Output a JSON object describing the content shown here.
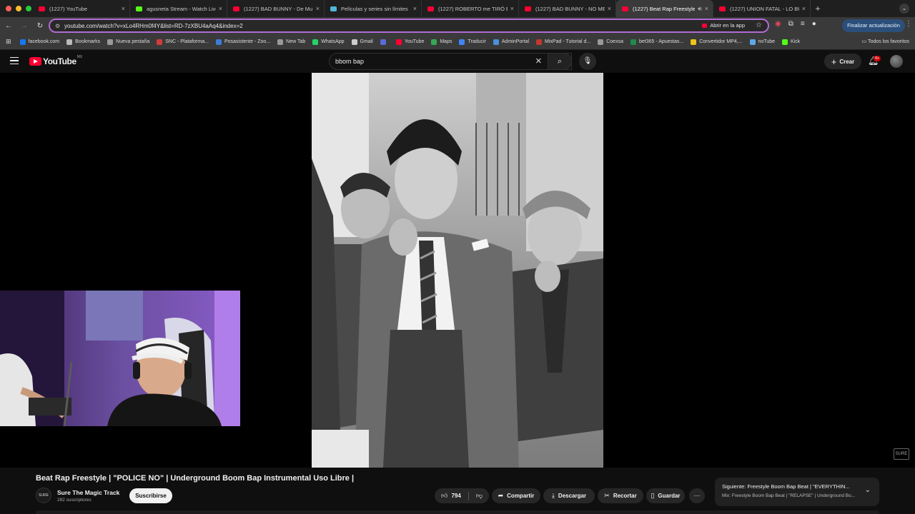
{
  "browser": {
    "tabs": [
      {
        "title": "(1227) YouTube",
        "icon": "youtube",
        "active": false
      },
      {
        "title": "agusneta Stream - Watch Live",
        "icon": "kick",
        "active": false
      },
      {
        "title": "(1227) BAD BUNNY - De Mu",
        "icon": "youtube",
        "active": false
      },
      {
        "title": "Películas y series sin límites",
        "icon": "pelis",
        "active": false
      },
      {
        "title": "(1227) ROBERTO me TIRÓ EL",
        "icon": "youtube",
        "active": false
      },
      {
        "title": "(1227) BAD BUNNY - NO ME",
        "icon": "youtube",
        "active": false
      },
      {
        "title": "(1227) Beat Rap Freestyle",
        "icon": "youtube",
        "active": true
      },
      {
        "title": "(1227) UNION FATAL - LO BU",
        "icon": "youtube",
        "active": false
      }
    ],
    "url": "youtube.com/watch?v=xLo4RHm0f4Y&list=RD-7zXBU4aAq4&index=2",
    "open_in_app": "Abrir en la app",
    "update_button": "Finalizar actualización",
    "bookmarks": [
      {
        "label": "facebook.com",
        "color": "#1877f2"
      },
      {
        "label": "Bookmarks",
        "color": "#bbbbbb"
      },
      {
        "label": "Nueva pestaña",
        "color": "#999999"
      },
      {
        "label": "SNC - Plataforma...",
        "color": "#d33b3b"
      },
      {
        "label": "Posasistente - Zoo...",
        "color": "#3b7dd8"
      },
      {
        "label": "New Tab",
        "color": "#999999"
      },
      {
        "label": "WhatsApp",
        "color": "#25d366"
      },
      {
        "label": "Gmail",
        "color": "#cccccc"
      },
      {
        "label": "",
        "color": "#5b6bd8"
      },
      {
        "label": "YouTube",
        "color": "#ff0033"
      },
      {
        "label": "Maps",
        "color": "#34a853"
      },
      {
        "label": "Traducir",
        "color": "#4285f4"
      },
      {
        "label": "AdminPortal",
        "color": "#4a90d9"
      },
      {
        "label": "MixPad - Tutorial d...",
        "color": "#c0392b"
      },
      {
        "label": "Coexsa",
        "color": "#999999"
      },
      {
        "label": "bet365 - Apuestas...",
        "color": "#1e8a4c"
      },
      {
        "label": "Convertidor MP4,...",
        "color": "#f0c419"
      },
      {
        "label": "noTube",
        "color": "#5fa8e8"
      },
      {
        "label": "Kick",
        "color": "#53fc18"
      }
    ],
    "all_favorites": "Todos los favoritos"
  },
  "youtube": {
    "region": "MX",
    "logo_text": "YouTube",
    "search_value": "bbom bap",
    "create_label": "Crear",
    "notification_badge": "9+"
  },
  "video": {
    "watermark": "SURE",
    "title": "Beat Rap Freestyle | \"POLICE NO\" | Underground Boom Bap Instrumental Uso Libre |",
    "channel_name": "Sure The Magic Track",
    "channel_avatar_text": "SURE",
    "subscribers": "282 suscriptores",
    "subscribe_label": "Suscribirse",
    "likes": "794",
    "share_label": "Compartir",
    "download_label": "Descargar",
    "clip_label": "Recortar",
    "save_label": "Guardar"
  },
  "next_up": {
    "title": "Siguiente: Freestyle Boom Bap Beat | \"EVERYTHIN...",
    "subtitle": "Mix: Freestyle Boom Bap Beat | \"RELAPSE\" | Underground Bo..."
  }
}
